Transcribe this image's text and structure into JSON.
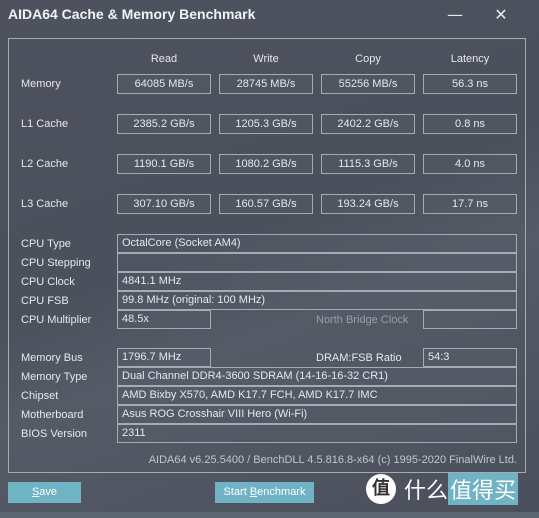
{
  "window": {
    "title": "AIDA64 Cache & Memory Benchmark",
    "minimize_icon": "minimize-icon",
    "close_icon": "close-icon"
  },
  "columns": [
    "Read",
    "Write",
    "Copy",
    "Latency"
  ],
  "rows": [
    {
      "label": "Memory",
      "read": "64085 MB/s",
      "write": "28745 MB/s",
      "copy": "55256 MB/s",
      "latency": "56.3 ns"
    },
    {
      "label": "L1 Cache",
      "read": "2385.2 GB/s",
      "write": "1205.3 GB/s",
      "copy": "2402.2 GB/s",
      "latency": "0.8 ns"
    },
    {
      "label": "L2 Cache",
      "read": "1190.1 GB/s",
      "write": "1080.2 GB/s",
      "copy": "1115.3 GB/s",
      "latency": "4.0 ns"
    },
    {
      "label": "L3 Cache",
      "read": "307.10 GB/s",
      "write": "160.57 GB/s",
      "copy": "193.24 GB/s",
      "latency": "17.7 ns"
    }
  ],
  "cpu": {
    "type_label": "CPU Type",
    "type_value": "OctalCore   (Socket AM4)",
    "stepping_label": "CPU Stepping",
    "stepping_value": "",
    "clock_label": "CPU Clock",
    "clock_value": "4841.1 MHz",
    "fsb_label": "CPU FSB",
    "fsb_value": "99.8 MHz  (original: 100 MHz)",
    "multiplier_label": "CPU Multiplier",
    "multiplier_value": "48.5x",
    "nb_clock_label": "North Bridge Clock",
    "nb_clock_value": ""
  },
  "memory": {
    "bus_label": "Memory Bus",
    "bus_value": "1796.7 MHz",
    "ratio_label": "DRAM:FSB Ratio",
    "ratio_value": "54:3",
    "type_label": "Memory Type",
    "type_value": "Dual Channel DDR4-3600 SDRAM  (14-16-16-32 CR1)",
    "chipset_label": "Chipset",
    "chipset_value": "AMD Bixby X570, AMD K17.7 FCH, AMD K17.7 IMC",
    "mobo_label": "Motherboard",
    "mobo_value": "Asus ROG Crosshair VIII Hero (Wi-Fi)",
    "bios_label": "BIOS Version",
    "bios_value": "2311"
  },
  "footer": "AIDA64 v6.25.5400 / BenchDLL 4.5.816.8-x64  (c) 1995-2020 FinalWire Ltd.",
  "buttons": {
    "save_first": "S",
    "save_rest": "ave",
    "start_pre": "Start ",
    "start_u": "B",
    "start_rest": "enchmark"
  },
  "watermark": {
    "circle": "值",
    "text1": "什么",
    "text2": "值得买"
  },
  "colors": {
    "accent": "#6fb3c4",
    "background": "#4a4f5b",
    "border": "#a6aab2"
  }
}
